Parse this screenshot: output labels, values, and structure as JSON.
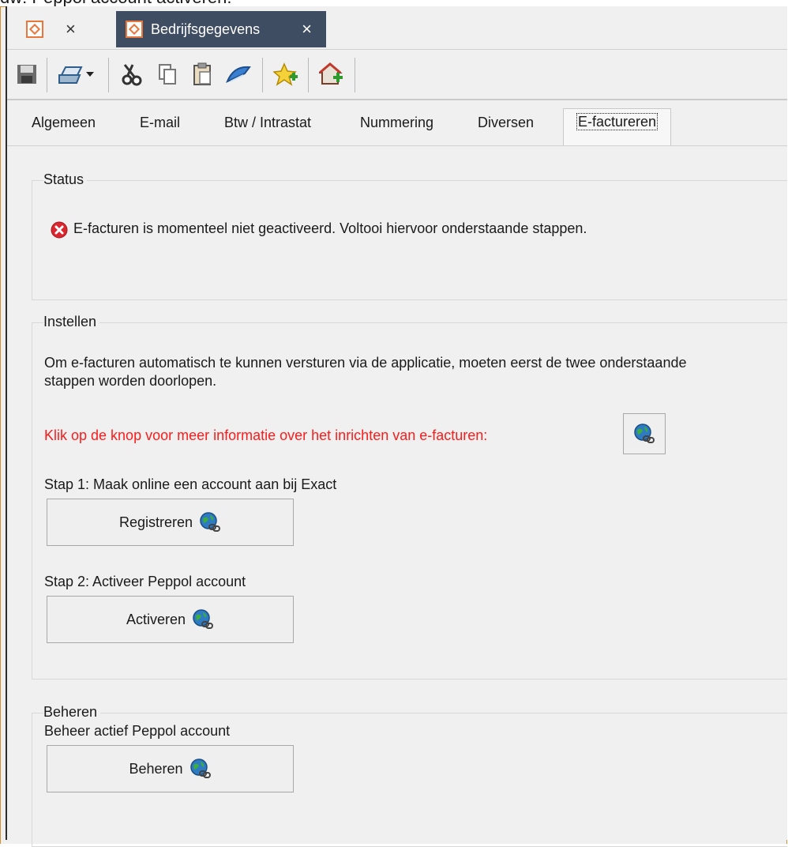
{
  "caption": "dw: Peppol account activeren:",
  "doc_tabs": [
    {
      "label": "",
      "close": "×"
    },
    {
      "label": "Bedrijfsgegevens",
      "close": "×"
    }
  ],
  "toolbar_icons": [
    "save-icon",
    "print-icon",
    "cut-icon",
    "copy-icon",
    "paste-icon",
    "link-icon",
    "favorite-add-icon",
    "home-add-icon"
  ],
  "section_tabs": [
    "Algemeen",
    "E-mail",
    "Btw / Intrastat",
    "Nummering",
    "Diversen",
    "E-factureren"
  ],
  "active_tab": "E-factureren",
  "status": {
    "title": "Status",
    "message": "E-facturen is momenteel niet geactiveerd. Voltooi hiervoor onderstaande stappen.",
    "icon": "error-icon",
    "icon_color": "#d9262f"
  },
  "instellen": {
    "title": "Instellen",
    "description": "Om e-facturen automatisch te kunnen versturen via de applicatie, moeten eerst de twee onderstaande stappen worden doorlopen.",
    "info_text": "Klik op de knop voor meer informatie over het inrichten van e-facturen:",
    "info_color": "#ff1b1b",
    "step1_label": "Stap 1: Maak online een account aan bij Exact",
    "step1_button": "Registreren",
    "step2_label": "Stap 2: Activeer Peppol account",
    "step2_button": "Activeren"
  },
  "beheren": {
    "title": "Beheren",
    "label": "Beheer actief Peppol account",
    "button": "Beheren"
  }
}
